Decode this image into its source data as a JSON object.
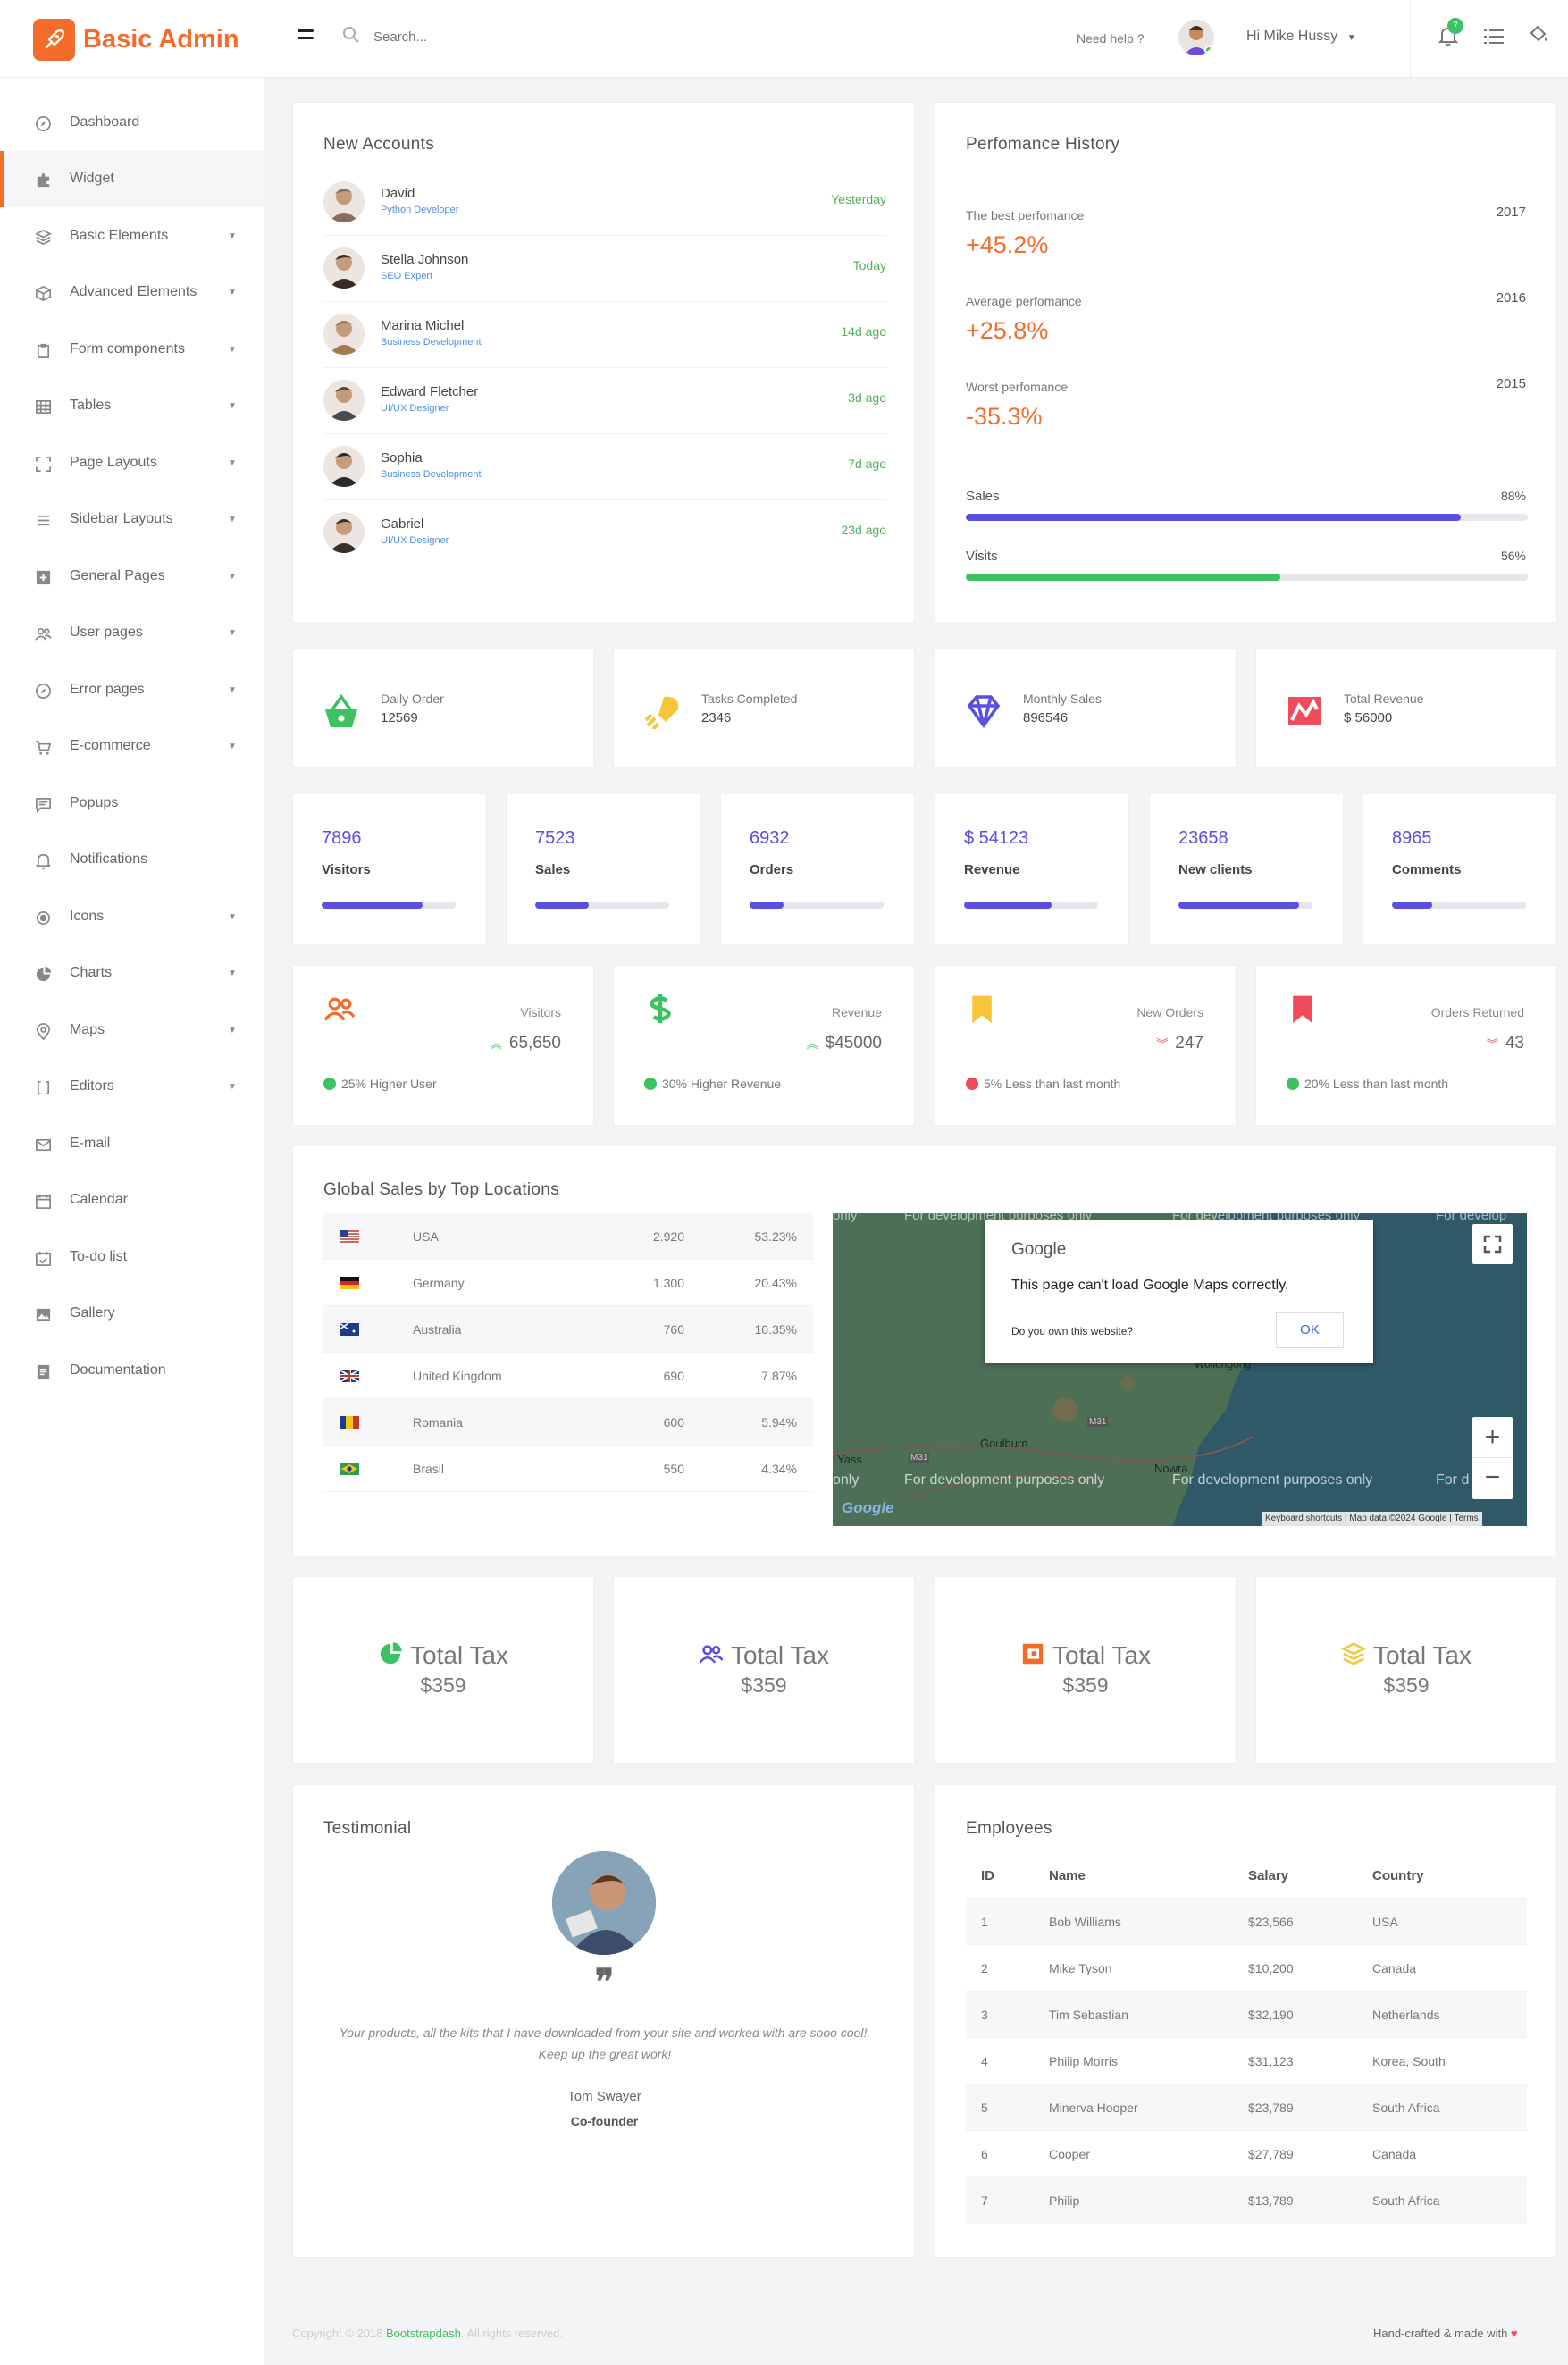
{
  "brand": {
    "name": "Basic Admin"
  },
  "header": {
    "search_placeholder": "Search...",
    "help": "Need help ?",
    "user": "Hi Mike Hussy",
    "notifications_count": "7"
  },
  "sidebar": {
    "items": [
      {
        "label": "Dashboard",
        "icon": "compass-icon",
        "caret": false
      },
      {
        "label": "Widget",
        "icon": "puzzle-icon",
        "caret": false,
        "active": true
      },
      {
        "label": "Basic Elements",
        "icon": "layers-icon",
        "caret": true
      },
      {
        "label": "Advanced Elements",
        "icon": "box-icon",
        "caret": true
      },
      {
        "label": "Form components",
        "icon": "clipboard-icon",
        "caret": true
      },
      {
        "label": "Tables",
        "icon": "grid-icon",
        "caret": true
      },
      {
        "label": "Page Layouts",
        "icon": "expand-icon",
        "caret": true
      },
      {
        "label": "Sidebar Layouts",
        "icon": "list-icon",
        "caret": true
      },
      {
        "label": "General Pages",
        "icon": "plus-square-icon",
        "caret": true
      },
      {
        "label": "User pages",
        "icon": "users-icon",
        "caret": true
      },
      {
        "label": "Error pages",
        "icon": "compass-icon",
        "caret": true
      },
      {
        "label": "E-commerce",
        "icon": "cart-icon",
        "caret": true
      },
      {
        "label": "Popups",
        "icon": "chat-icon",
        "caret": false
      },
      {
        "label": "Notifications",
        "icon": "bell-icon",
        "caret": false
      },
      {
        "label": "Icons",
        "icon": "circle-icon",
        "caret": true
      },
      {
        "label": "Charts",
        "icon": "pie-icon",
        "caret": true
      },
      {
        "label": "Maps",
        "icon": "pin-icon",
        "caret": true
      },
      {
        "label": "Editors",
        "icon": "brackets-icon",
        "caret": true
      },
      {
        "label": "E-mail",
        "icon": "mail-icon",
        "caret": false
      },
      {
        "label": "Calendar",
        "icon": "calendar-icon",
        "caret": false
      },
      {
        "label": "To-do list",
        "icon": "todo-icon",
        "caret": false
      },
      {
        "label": "Gallery",
        "icon": "image-icon",
        "caret": false
      },
      {
        "label": "Documentation",
        "icon": "document-icon",
        "caret": false
      }
    ]
  },
  "accounts": {
    "title": "New Accounts",
    "items": [
      {
        "name": "David",
        "role": "Python Developer",
        "time": "Yesterday",
        "color": "#8a6d5a"
      },
      {
        "name": "Stella Johnson",
        "role": "SEO Expert",
        "time": "Today",
        "color": "#3a2a26"
      },
      {
        "name": "Marina Michel",
        "role": "Business Development",
        "time": "14d ago",
        "color": "#a37a52"
      },
      {
        "name": "Edward Fletcher",
        "role": "UI/UX Designer",
        "time": "3d ago",
        "color": "#4a4a4a"
      },
      {
        "name": "Sophia",
        "role": "Business Development",
        "time": "7d ago",
        "color": "#2b2b2b"
      },
      {
        "name": "Gabriel",
        "role": "UI/UX Designer",
        "time": "23d ago",
        "color": "#3a2f2a"
      }
    ]
  },
  "performance": {
    "title": "Perfomance History",
    "items": [
      {
        "label": "The best perfomance",
        "value": "+45.2%",
        "year": "2017"
      },
      {
        "label": "Average perfomance",
        "value": "+25.8%",
        "year": "2016"
      },
      {
        "label": "Worst perfomance",
        "value": "-35.3%",
        "year": "2015"
      }
    ],
    "bars": [
      {
        "label": "Sales",
        "percent": "88%",
        "fraction": 0.88,
        "color": "#5b4fe2"
      },
      {
        "label": "Visits",
        "percent": "56%",
        "fraction": 0.56,
        "color": "#3cc262"
      }
    ]
  },
  "stats_icons": [
    {
      "label": "Daily Order",
      "value": "12569",
      "icon": "basket-icon",
      "color": "#3cc262"
    },
    {
      "label": "Tasks Completed",
      "value": "2346",
      "icon": "rocket-icon",
      "color": "#f5c63a"
    },
    {
      "label": "Monthly Sales",
      "value": "896546",
      "icon": "diamond-icon",
      "color": "#5b4fe2"
    },
    {
      "label": "Total Revenue",
      "value": "$ 56000",
      "icon": "chart-icon",
      "color": "#f04b5b"
    }
  ],
  "stats_bars": [
    {
      "value": "7896",
      "label": "Visitors",
      "fraction": 0.75
    },
    {
      "value": "7523",
      "label": "Sales",
      "fraction": 0.4
    },
    {
      "value": "6932",
      "label": "Orders",
      "fraction": 0.25
    },
    {
      "value": "$ 54123",
      "label": "Revenue",
      "fraction": 0.65
    },
    {
      "value": "23658",
      "label": "New clients",
      "fraction": 0.9
    },
    {
      "value": "8965",
      "label": "Comments",
      "fraction": 0.3
    }
  ],
  "stats_trend": [
    {
      "label": "Visitors",
      "value": "65,650",
      "note": "25% Higher User",
      "icon": "users-icon",
      "color": "#f36c2b",
      "dir": "up",
      "dot": "#3cc262"
    },
    {
      "label": "Revenue",
      "value": "$45000",
      "note": "30% Higher Revenue",
      "icon": "dollar-icon",
      "color": "#3cc262",
      "dir": "up",
      "dot": "#3cc262"
    },
    {
      "label": "New Orders",
      "value": "247",
      "note": "5% Less than last month",
      "icon": "bookmark-icon",
      "color": "#f5c63a",
      "dir": "down",
      "dot": "#f04b5b"
    },
    {
      "label": "Orders Returned",
      "value": "43",
      "note": "20% Less than last month",
      "icon": "bookmark-icon",
      "color": "#f04b5b",
      "dir": "down",
      "dot": "#3cc262"
    }
  ],
  "global_sales": {
    "title": "Global Sales by Top Locations",
    "rows": [
      {
        "country": "USA",
        "value": "2.920",
        "percent": "53.23%",
        "flag": "us"
      },
      {
        "country": "Germany",
        "value": "1.300",
        "percent": "20.43%",
        "flag": "de"
      },
      {
        "country": "Australia",
        "value": "760",
        "percent": "10.35%",
        "flag": "au"
      },
      {
        "country": "United Kingdom",
        "value": "690",
        "percent": "7.87%",
        "flag": "gb"
      },
      {
        "country": "Romania",
        "value": "600",
        "percent": "5.94%",
        "flag": "ro"
      },
      {
        "country": "Brasil",
        "value": "550",
        "percent": "4.34%",
        "flag": "br"
      }
    ]
  },
  "map": {
    "google": "Google",
    "error": "This page can't load Google Maps correctly.",
    "question": "Do you own this website?",
    "ok": "OK",
    "watermark": "For development purposes only",
    "watermark_cut": "For develop",
    "watermark_left": "only",
    "watermark_right": "For d",
    "places": [
      "Goulburn",
      "Yass",
      "Nowra",
      "Wollongong"
    ],
    "roads": [
      "M31",
      "M31"
    ],
    "footer": [
      "Keyboard shortcuts",
      "Map data ©2024 Google",
      "Terms"
    ],
    "zoom_in": "+",
    "zoom_out": "−",
    "logo": "Google"
  },
  "tax": [
    {
      "title": "Total Tax",
      "value": "$359",
      "icon": "pie-icon",
      "color": "#3cc262"
    },
    {
      "title": "Total Tax",
      "value": "$359",
      "icon": "users-icon",
      "color": "#5b4fe2"
    },
    {
      "title": "Total Tax",
      "value": "$359",
      "icon": "wallet-icon",
      "color": "#f36c2b"
    },
    {
      "title": "Total Tax",
      "value": "$359",
      "icon": "layers-icon",
      "color": "#f5c63a"
    }
  ],
  "testimonial": {
    "title": "Testimonial",
    "quote": "Your products, all the kits that I have downloaded from your site and worked with are sooo cool!. Keep up the great work!",
    "name": "Tom Swayer",
    "position": "Co-founder",
    "quote_mark": "❞"
  },
  "employees": {
    "title": "Employees",
    "headers": [
      "ID",
      "Name",
      "Salary",
      "Country"
    ],
    "rows": [
      [
        "1",
        "Bob Williams",
        "$23,566",
        "USA"
      ],
      [
        "2",
        "Mike Tyson",
        "$10,200",
        "Canada"
      ],
      [
        "3",
        "Tim Sebastian",
        "$32,190",
        "Netherlands"
      ],
      [
        "4",
        "Philip Morris",
        "$31,123",
        "Korea, South"
      ],
      [
        "5",
        "Minerva Hooper",
        "$23,789",
        "South Africa"
      ],
      [
        "6",
        "Cooper",
        "$27,789",
        "Canada"
      ],
      [
        "7",
        "Philip",
        "$13,789",
        "South Africa"
      ]
    ]
  },
  "footer": {
    "copyright_pre": "Copyright © 2018 ",
    "link": "Bootstrapdash",
    "copyright_post": ". All rights reserved.",
    "made": "Hand-crafted & made with",
    "heart": "♥"
  },
  "colors": {
    "accent": "#f36c2b",
    "primary": "#5b4fe2",
    "success": "#3cc262",
    "warning": "#f5c63a",
    "danger": "#f04b5b"
  }
}
